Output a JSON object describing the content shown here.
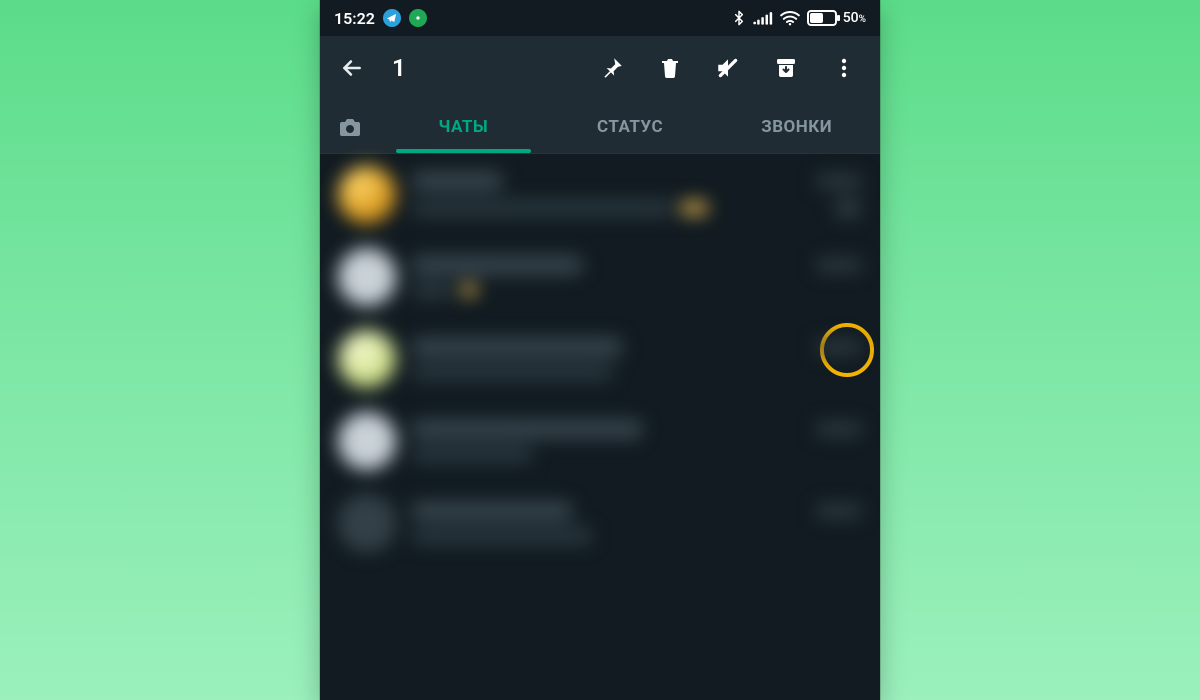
{
  "statusbar": {
    "time": "15:22",
    "battery_percent": "50",
    "percent_suffix": "%"
  },
  "selection": {
    "count": "1"
  },
  "tabs": {
    "chats": "ЧАТЫ",
    "status": "СТАТУС",
    "calls": "ЗВОНКИ"
  },
  "colors": {
    "highlight": "#f5b400",
    "accent": "#00a884",
    "bg_dark": "#111b21",
    "toolbar": "#202c33"
  }
}
